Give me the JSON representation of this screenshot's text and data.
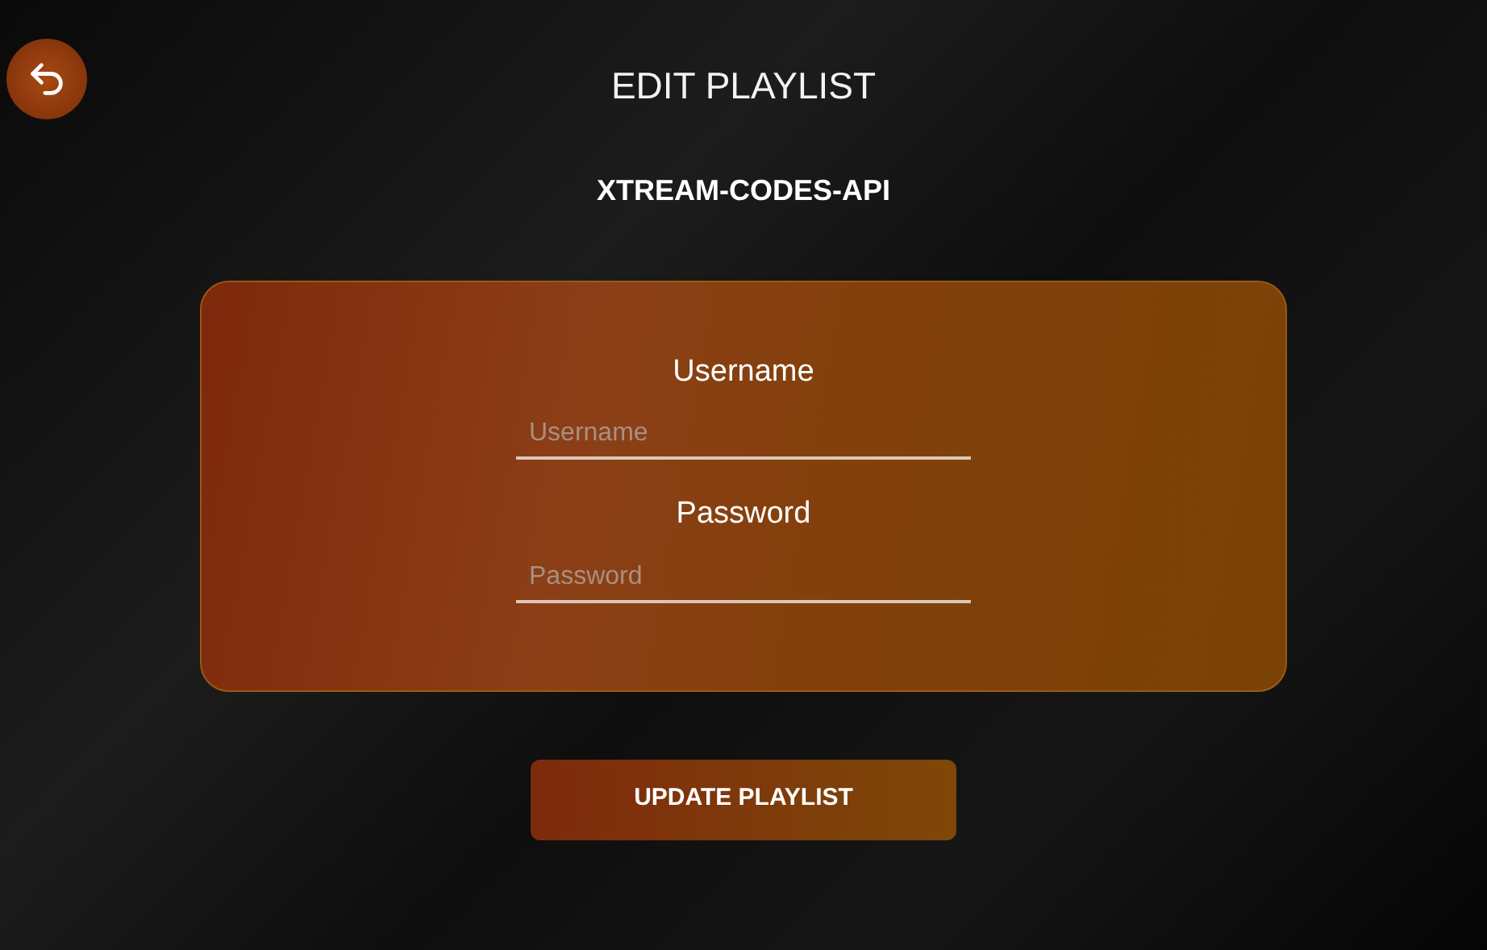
{
  "title": "EDIT PLAYLIST",
  "subtitle": "XTREAM-CODES-API",
  "fields": [
    {
      "label": "Username",
      "placeholder": "Username"
    },
    {
      "label": "Password",
      "placeholder": "Password"
    }
  ],
  "button": "UPDATE PLAYLIST"
}
